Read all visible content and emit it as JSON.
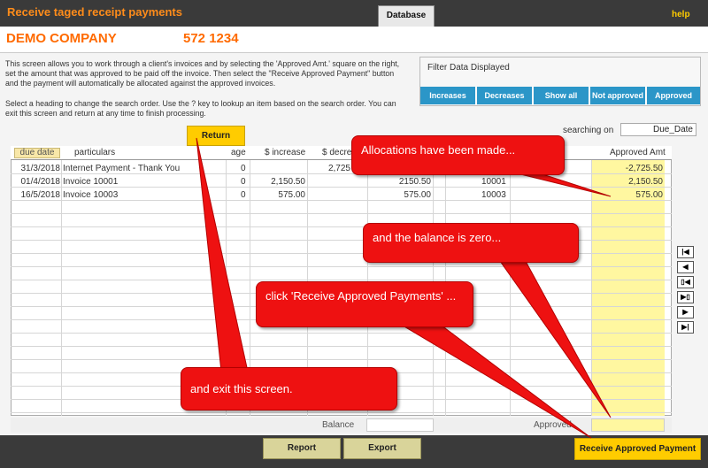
{
  "header": {
    "title": "Receive taged receipt payments",
    "db_tab": "Database",
    "help": "help"
  },
  "company": {
    "name": "DEMO COMPANY",
    "phone": "572 1234"
  },
  "instructions": {
    "p1": "This screen allows you to work through a client's invoices and by selecting the 'Approved Amt.' square on the right, set the amount that was approved to be paid off the invoice. Then select the \"Receive Approved Payment\" button and the payment will automatically be allocated against the approved invoices.",
    "p2": "Select a heading to change the search order. Use the ? key to lookup an item based on the search order. You can exit this screen and return at any time to finish processing."
  },
  "filter": {
    "title": "Filter Data Displayed",
    "buttons": [
      "Increases",
      "Decreases",
      "Show all",
      "Not approved",
      "Approved"
    ]
  },
  "search": {
    "label": "searching on",
    "value": "Due_Date"
  },
  "return_label": "Return",
  "table": {
    "headers": {
      "due_date": "due date",
      "particulars": "particulars",
      "age": "age",
      "increase": "$ increase",
      "decrease": "$ decre",
      "approved": "Approved Amt"
    },
    "rows": [
      {
        "date": "31/3/2018",
        "particulars": "Internet Payment - Thank You",
        "age": "0",
        "increase": "",
        "decrease": "2,725",
        "amount": "",
        "ref": "",
        "approved": "-2,725.50"
      },
      {
        "date": "01/4/2018",
        "particulars": "Invoice 10001",
        "age": "0",
        "increase": "2,150.50",
        "decrease": "",
        "amount": "2150.50",
        "ref": "10001",
        "approved": "2,150.50"
      },
      {
        "date": "16/5/2018",
        "particulars": "Invoice 10003",
        "age": "0",
        "increase": "575.00",
        "decrease": "",
        "amount": "575.00",
        "ref": "10003",
        "approved": "575.00"
      }
    ]
  },
  "nav": [
    "first-record",
    "previous-record",
    "new-record-before",
    "new-record-after",
    "next-record",
    "last-record"
  ],
  "footer": {
    "balance_label": "Balance",
    "approved_label": "Approved",
    "report": "Report",
    "export": "Export",
    "receive": "Receive Approved Payment"
  },
  "callouts": {
    "c1": "Allocations have been made...",
    "c2": "and the balance is zero...",
    "c3": "click 'Receive Approved Payments' ...",
    "c4": "and exit this screen."
  },
  "colors": {
    "accent_orange": "#ff6a00",
    "yellow": "#ffcc00",
    "filter_blue": "#2b96c8",
    "callout_red": "#ee1111"
  }
}
